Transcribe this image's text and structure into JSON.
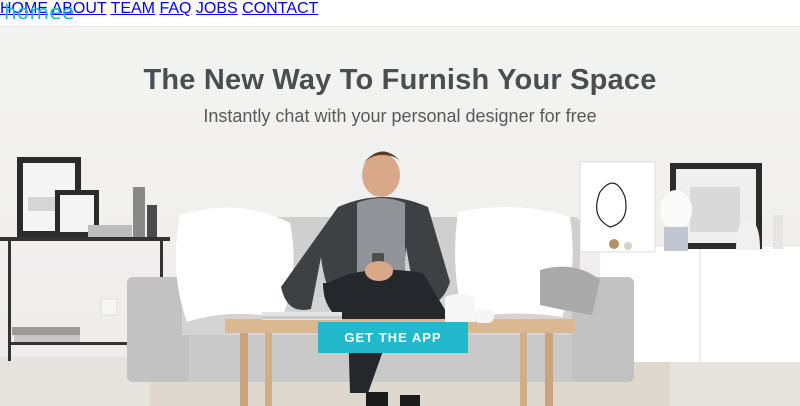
{
  "brand": {
    "logo_text": "homee",
    "accent": "#22b9cd"
  },
  "nav": {
    "items": [
      {
        "label": "HOME"
      },
      {
        "label": "ABOUT"
      },
      {
        "label": "TEAM"
      },
      {
        "label": "FAQ"
      },
      {
        "label": "JOBS"
      },
      {
        "label": "CONTACT"
      }
    ]
  },
  "hero": {
    "title": "The New Way To Furnish Your Space",
    "subtitle": "Instantly chat with your personal designer for free",
    "cta_label": "GET THE APP"
  }
}
